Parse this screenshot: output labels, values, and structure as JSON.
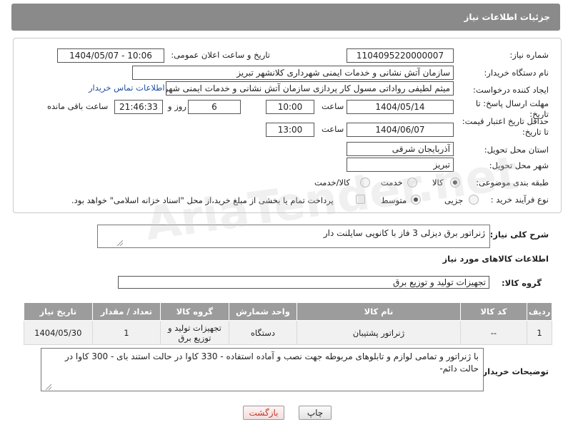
{
  "header": {
    "title": "جزئیات اطلاعات نیاز"
  },
  "form": {
    "need_number": {
      "label": "شماره نیاز:",
      "value": "1104095220000007"
    },
    "announce_datetime": {
      "label": "تاریخ و ساعت اعلان عمومی:",
      "value": "1404/05/07 - 10:06"
    },
    "buyer_org": {
      "label": "نام دستگاه خریدار:",
      "value": "سازمان آتش نشانی و خدمات ایمنی شهرداری کلانشهر تبریز"
    },
    "requester": {
      "label": "ایجاد کننده درخواست:",
      "value": "میثم لطیفی رواداتی مسول کار پردازی سازمان آتش نشانی و خدمات ایمنی شهرداری کلانشهر تبریز",
      "contact_link": "اطلاعات تماس خریدار"
    },
    "reply_deadline": {
      "label": "مهلت ارسال پاسخ: تا تاریخ:",
      "date": "1404/05/14",
      "time_label": "ساعت",
      "time": "10:00",
      "days": "6",
      "days_label": "روز و",
      "remaining": "21:46:33",
      "remaining_label": "ساعت باقی مانده"
    },
    "price_validity": {
      "label": "حداقل تاریخ اعتبار قیمت: تا تاریخ:",
      "date": "1404/06/07",
      "time_label": "ساعت",
      "time": "13:00"
    },
    "delivery_province": {
      "label": "استان محل تحویل:",
      "value": "آذربایجان شرقی"
    },
    "delivery_city": {
      "label": "شهر محل تحویل:",
      "value": "تبریز"
    },
    "category": {
      "label": "طبقه بندی موضوعی:",
      "options": [
        "کالا",
        "خدمت",
        "کالا/خدمت"
      ],
      "selected": "کالا"
    },
    "purchase_type": {
      "label": "نوع فرآیند خرید :",
      "options": [
        "جزیی",
        "متوسط"
      ],
      "selected": "متوسط",
      "note": "پرداخت تمام یا بخشی از مبلغ خرید،از محل \"اسناد خزانه اسلامی\" خواهد بود."
    }
  },
  "summary": {
    "label": "شرح کلی نیاز:",
    "value": "ژنراتور برق دیزلی 3 فاز با کانوپی سایلنت دار"
  },
  "goods_section": {
    "title": "اطلاعات کالاهای مورد نیاز",
    "group_label": "گروه کالا:",
    "group_value": "تجهیزات تولید و توزیع برق"
  },
  "table": {
    "headers": [
      "ردیف",
      "کد کالا",
      "نام کالا",
      "واحد شمارش",
      "گروه کالا",
      "تعداد / مقدار",
      "تاریخ نیاز"
    ],
    "rows": [
      {
        "row": "1",
        "code": "--",
        "name": "ژنراتور پشتیبان",
        "unit": "دستگاه",
        "group": "تجهیزات تولید و توزیع برق",
        "qty": "1",
        "date": "1404/05/30"
      }
    ]
  },
  "buyer_notes": {
    "label": "توضیحات خریدار:",
    "value": "با ژنراتور و تمامی لوازم و تابلوهای مربوطه جهت نصب و آماده استفاده - 330 کاوا در حالت استند بای - 300 کاوا در حالت دائم-"
  },
  "buttons": {
    "print": "چاپ",
    "back": "بازگشت"
  },
  "watermark": "AriaTender.net",
  "colors": {
    "header_bg": "#8a8a8a",
    "table_header_bg": "#9c9c9c",
    "link": "#1f4fa3",
    "back_button_text": "#c0392b"
  }
}
